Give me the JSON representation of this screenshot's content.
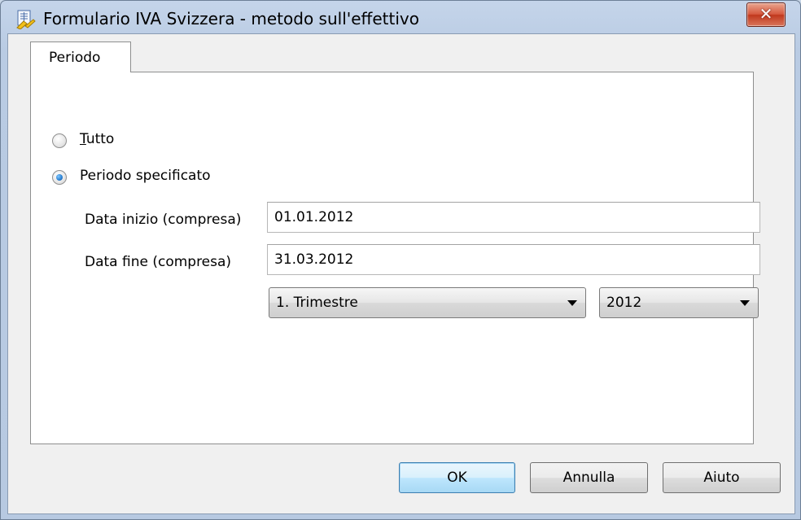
{
  "window": {
    "title": "Formulario IVA Svizzera - metodo sull'effettivo",
    "close_glyph": "✕",
    "icon": "form-icon"
  },
  "tabs": [
    {
      "label": "Periodo",
      "active": true
    }
  ],
  "period": {
    "option_all": {
      "label_first": "T",
      "label_rest": "utto",
      "selected": false
    },
    "option_specified": {
      "label": "Periodo specificato",
      "selected": true
    },
    "start_date": {
      "label": "Data inizio (compresa)",
      "value": "01.01.2012"
    },
    "end_date": {
      "label": "Data fine (compresa)",
      "value": "31.03.2012"
    },
    "quarter_select": {
      "value": "1. Trimestre"
    },
    "year_select": {
      "value": "2012"
    }
  },
  "buttons": {
    "ok": "OK",
    "cancel": "Annulla",
    "help": "Aiuto"
  },
  "colors": {
    "default_button_border": "#3c7fb1",
    "close_button": "#c0381d"
  }
}
